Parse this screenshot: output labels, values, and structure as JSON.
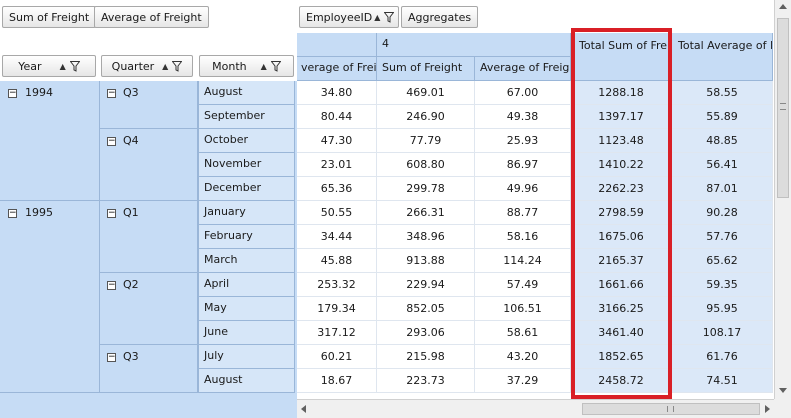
{
  "data_fields": [
    "Sum of Freight",
    "Average of Freight"
  ],
  "column_field": "EmployeeID",
  "aggregates_label": "Aggregates",
  "row_fields": [
    "Year",
    "Quarter",
    "Month"
  ],
  "column_group": "4",
  "column_headers": [
    "verage of Freigh",
    "Sum of Freight",
    "Average of Freight",
    "Total Sum of Freig",
    "Total Average of F"
  ],
  "years": [
    {
      "label": "1994",
      "quarters": [
        {
          "label": "Q3",
          "count": 2
        },
        {
          "label": "Q4",
          "count": 3
        }
      ]
    },
    {
      "label": "1995",
      "quarters": [
        {
          "label": "Q1",
          "count": 3
        },
        {
          "label": "Q2",
          "count": 3
        },
        {
          "label": "Q3",
          "count": 2
        }
      ]
    }
  ],
  "rows": [
    {
      "month": "August",
      "values": [
        "34.80",
        "469.01",
        "67.00",
        "1288.18",
        "58.55"
      ]
    },
    {
      "month": "September",
      "values": [
        "80.44",
        "246.90",
        "49.38",
        "1397.17",
        "55.89"
      ]
    },
    {
      "month": "October",
      "values": [
        "47.30",
        "77.79",
        "25.93",
        "1123.48",
        "48.85"
      ]
    },
    {
      "month": "November",
      "values": [
        "23.01",
        "608.80",
        "86.97",
        "1410.22",
        "56.41"
      ]
    },
    {
      "month": "December",
      "values": [
        "65.36",
        "299.78",
        "49.96",
        "2262.23",
        "87.01"
      ]
    },
    {
      "month": "January",
      "values": [
        "50.55",
        "266.31",
        "88.77",
        "2798.59",
        "90.28"
      ]
    },
    {
      "month": "February",
      "values": [
        "34.44",
        "348.96",
        "58.16",
        "1675.06",
        "57.76"
      ]
    },
    {
      "month": "March",
      "values": [
        "45.88",
        "913.88",
        "114.24",
        "2165.37",
        "65.62"
      ]
    },
    {
      "month": "April",
      "values": [
        "253.32",
        "229.94",
        "57.49",
        "1661.66",
        "59.35"
      ]
    },
    {
      "month": "May",
      "values": [
        "179.34",
        "852.05",
        "106.51",
        "3166.25",
        "95.95"
      ]
    },
    {
      "month": "June",
      "values": [
        "317.12",
        "293.06",
        "58.61",
        "3461.40",
        "108.17"
      ]
    },
    {
      "month": "July",
      "values": [
        "60.21",
        "215.98",
        "43.20",
        "1852.65",
        "61.76"
      ]
    },
    {
      "month": "August",
      "values": [
        "18.67",
        "223.73",
        "37.29",
        "2458.72",
        "74.51"
      ]
    }
  ],
  "colors": {
    "header_bg": "#c6dcf5",
    "highlight": "#d91f26"
  }
}
